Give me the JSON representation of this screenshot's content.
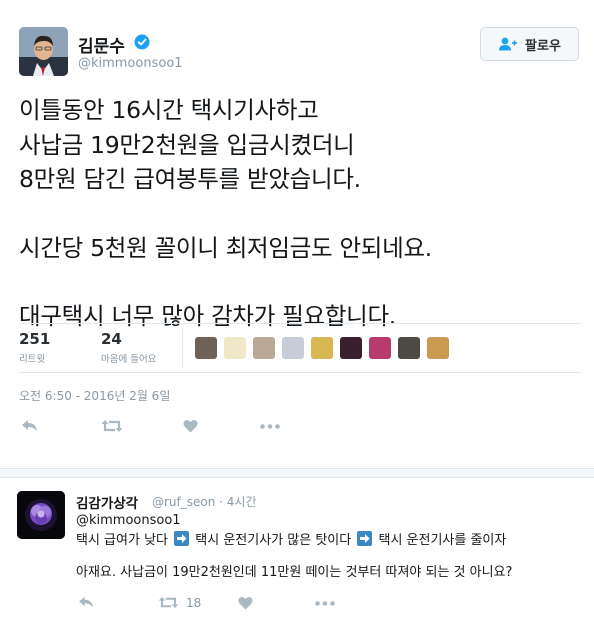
{
  "tweet": {
    "author_name": "김문수",
    "author_handle": "@kimmoonsoo1",
    "follow_label": "팔로우",
    "lines": [
      "이틀동안 16시간 택시기사하고",
      "사납금 19만2천원을 입금시켰더니",
      "8만원 담긴 급여봉투를 받았습니다.",
      "시간당 5천원 꼴이니 최저임금도 안되네요.",
      "대구택시 너무 많아 감차가 필요합니다."
    ],
    "retweets": "251",
    "retweets_label": "리트윗",
    "likes": "24",
    "likes_label": "마음에 들어요",
    "timestamp": "오전 6:50 - 2016년 2월 6일",
    "liker_count": 9,
    "colors": {
      "verified": "#1da1f2",
      "text": "#14171a",
      "muted": "#8899a6"
    },
    "icons": [
      "reply-icon",
      "retweet-icon",
      "like-icon",
      "more-icon"
    ]
  },
  "reply": {
    "author_name": "김감가상각",
    "author_handle": "@ruf_seon · 4시간",
    "mention": "@kimmoonsoo1",
    "line1": [
      "택시 급여가 낮다",
      "택시 운전기사가 많은 탓이다",
      "택시 운전기사를 줄이자"
    ],
    "line2": "아재요. 사납금이 19만2천원인데 11만원 떼이는 것부터 따져야 되는 것 아니요?",
    "retweet_count": "18",
    "colors": {
      "arrow_box": "#3b88c3"
    }
  }
}
